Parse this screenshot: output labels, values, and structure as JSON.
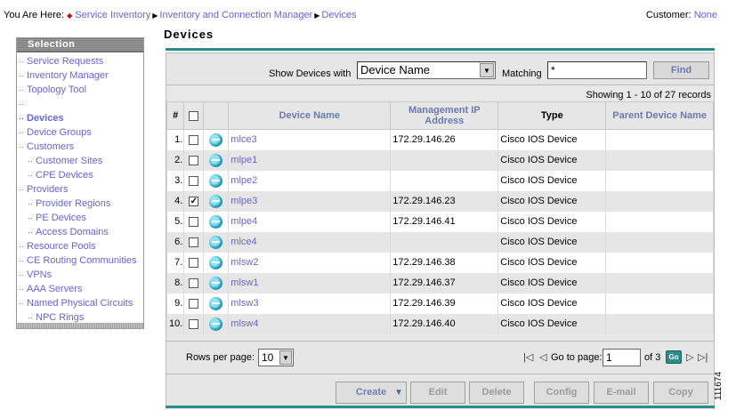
{
  "breadcrumb": {
    "prefix": "You Are Here:",
    "items": [
      "Service Inventory",
      "Inventory and Connection Manager",
      "Devices"
    ]
  },
  "customer": {
    "label": "Customer:",
    "value": "None"
  },
  "sidebar": {
    "title": "Selection",
    "items": [
      {
        "label": "Service Requests",
        "level": 1
      },
      {
        "label": "Inventory Manager",
        "level": 1
      },
      {
        "label": "Topology Tool",
        "level": 1
      },
      {
        "label": "",
        "level": 1
      },
      {
        "label": "Devices",
        "level": 1,
        "active": true
      },
      {
        "label": "Device Groups",
        "level": 1
      },
      {
        "label": "Customers",
        "level": 1
      },
      {
        "label": "Customer Sites",
        "level": 2
      },
      {
        "label": "CPE Devices",
        "level": 2
      },
      {
        "label": "Providers",
        "level": 1
      },
      {
        "label": "Provider Regions",
        "level": 2
      },
      {
        "label": "PE Devices",
        "level": 2
      },
      {
        "label": "Access Domains",
        "level": 2
      },
      {
        "label": "Resource Pools",
        "level": 1
      },
      {
        "label": "CE Routing Communities",
        "level": 1
      },
      {
        "label": "VPNs",
        "level": 1
      },
      {
        "label": "AAA Servers",
        "level": 1
      },
      {
        "label": "Named Physical Circuits",
        "level": 1
      },
      {
        "label": "NPC Rings",
        "level": 2
      }
    ]
  },
  "page": {
    "title": "Devices"
  },
  "filter": {
    "show_label": "Show Devices with",
    "field_value": "Device Name",
    "matching_label": "Matching",
    "matching_value": "*",
    "find_label": "Find"
  },
  "showing": "Showing 1 - 10 of 27 records",
  "table": {
    "headers": {
      "num": "#",
      "device_name": "Device Name",
      "mgmt_ip": "Management IP Address",
      "type": "Type",
      "parent": "Parent Device Name"
    },
    "rows": [
      {
        "num": "1.",
        "name": "mlce3",
        "ip": "172.29.146.26",
        "type": "Cisco IOS Device",
        "parent": "",
        "checked": false
      },
      {
        "num": "2.",
        "name": "mlpe1",
        "ip": "",
        "type": "Cisco IOS Device",
        "parent": "",
        "checked": false
      },
      {
        "num": "3.",
        "name": "mlpe2",
        "ip": "",
        "type": "Cisco IOS Device",
        "parent": "",
        "checked": false
      },
      {
        "num": "4.",
        "name": "mlpe3",
        "ip": "172.29.146.23",
        "type": "Cisco IOS Device",
        "parent": "",
        "checked": true
      },
      {
        "num": "5.",
        "name": "mlpe4",
        "ip": "172.29.146.41",
        "type": "Cisco IOS Device",
        "parent": "",
        "checked": false
      },
      {
        "num": "6.",
        "name": "mlce4",
        "ip": "",
        "type": "Cisco IOS Device",
        "parent": "",
        "checked": false
      },
      {
        "num": "7.",
        "name": "mlsw2",
        "ip": "172.29.146.38",
        "type": "Cisco IOS Device",
        "parent": "",
        "checked": false
      },
      {
        "num": "8.",
        "name": "mlsw1",
        "ip": "172.29.146.37",
        "type": "Cisco IOS Device",
        "parent": "",
        "checked": false
      },
      {
        "num": "9.",
        "name": "mlsw3",
        "ip": "172.29.146.39",
        "type": "Cisco IOS Device",
        "parent": "",
        "checked": false
      },
      {
        "num": "10.",
        "name": "mlsw4",
        "ip": "172.29.146.40",
        "type": "Cisco IOS Device",
        "parent": "",
        "checked": false
      }
    ]
  },
  "pager": {
    "rows_label": "Rows per page:",
    "rows_value": "10",
    "goto_label": "Go to page:",
    "page_value": "1",
    "of_label": "of 3",
    "go_label": "Go"
  },
  "actions": {
    "create": "Create",
    "edit": "Edit",
    "delete": "Delete",
    "config": "Config",
    "email": "E-mail",
    "copy": "Copy"
  },
  "figure_number": "111674",
  "colors": {
    "accent": "#2e8b8b",
    "link": "#6666cc",
    "active_bullet": "#cc0000"
  }
}
